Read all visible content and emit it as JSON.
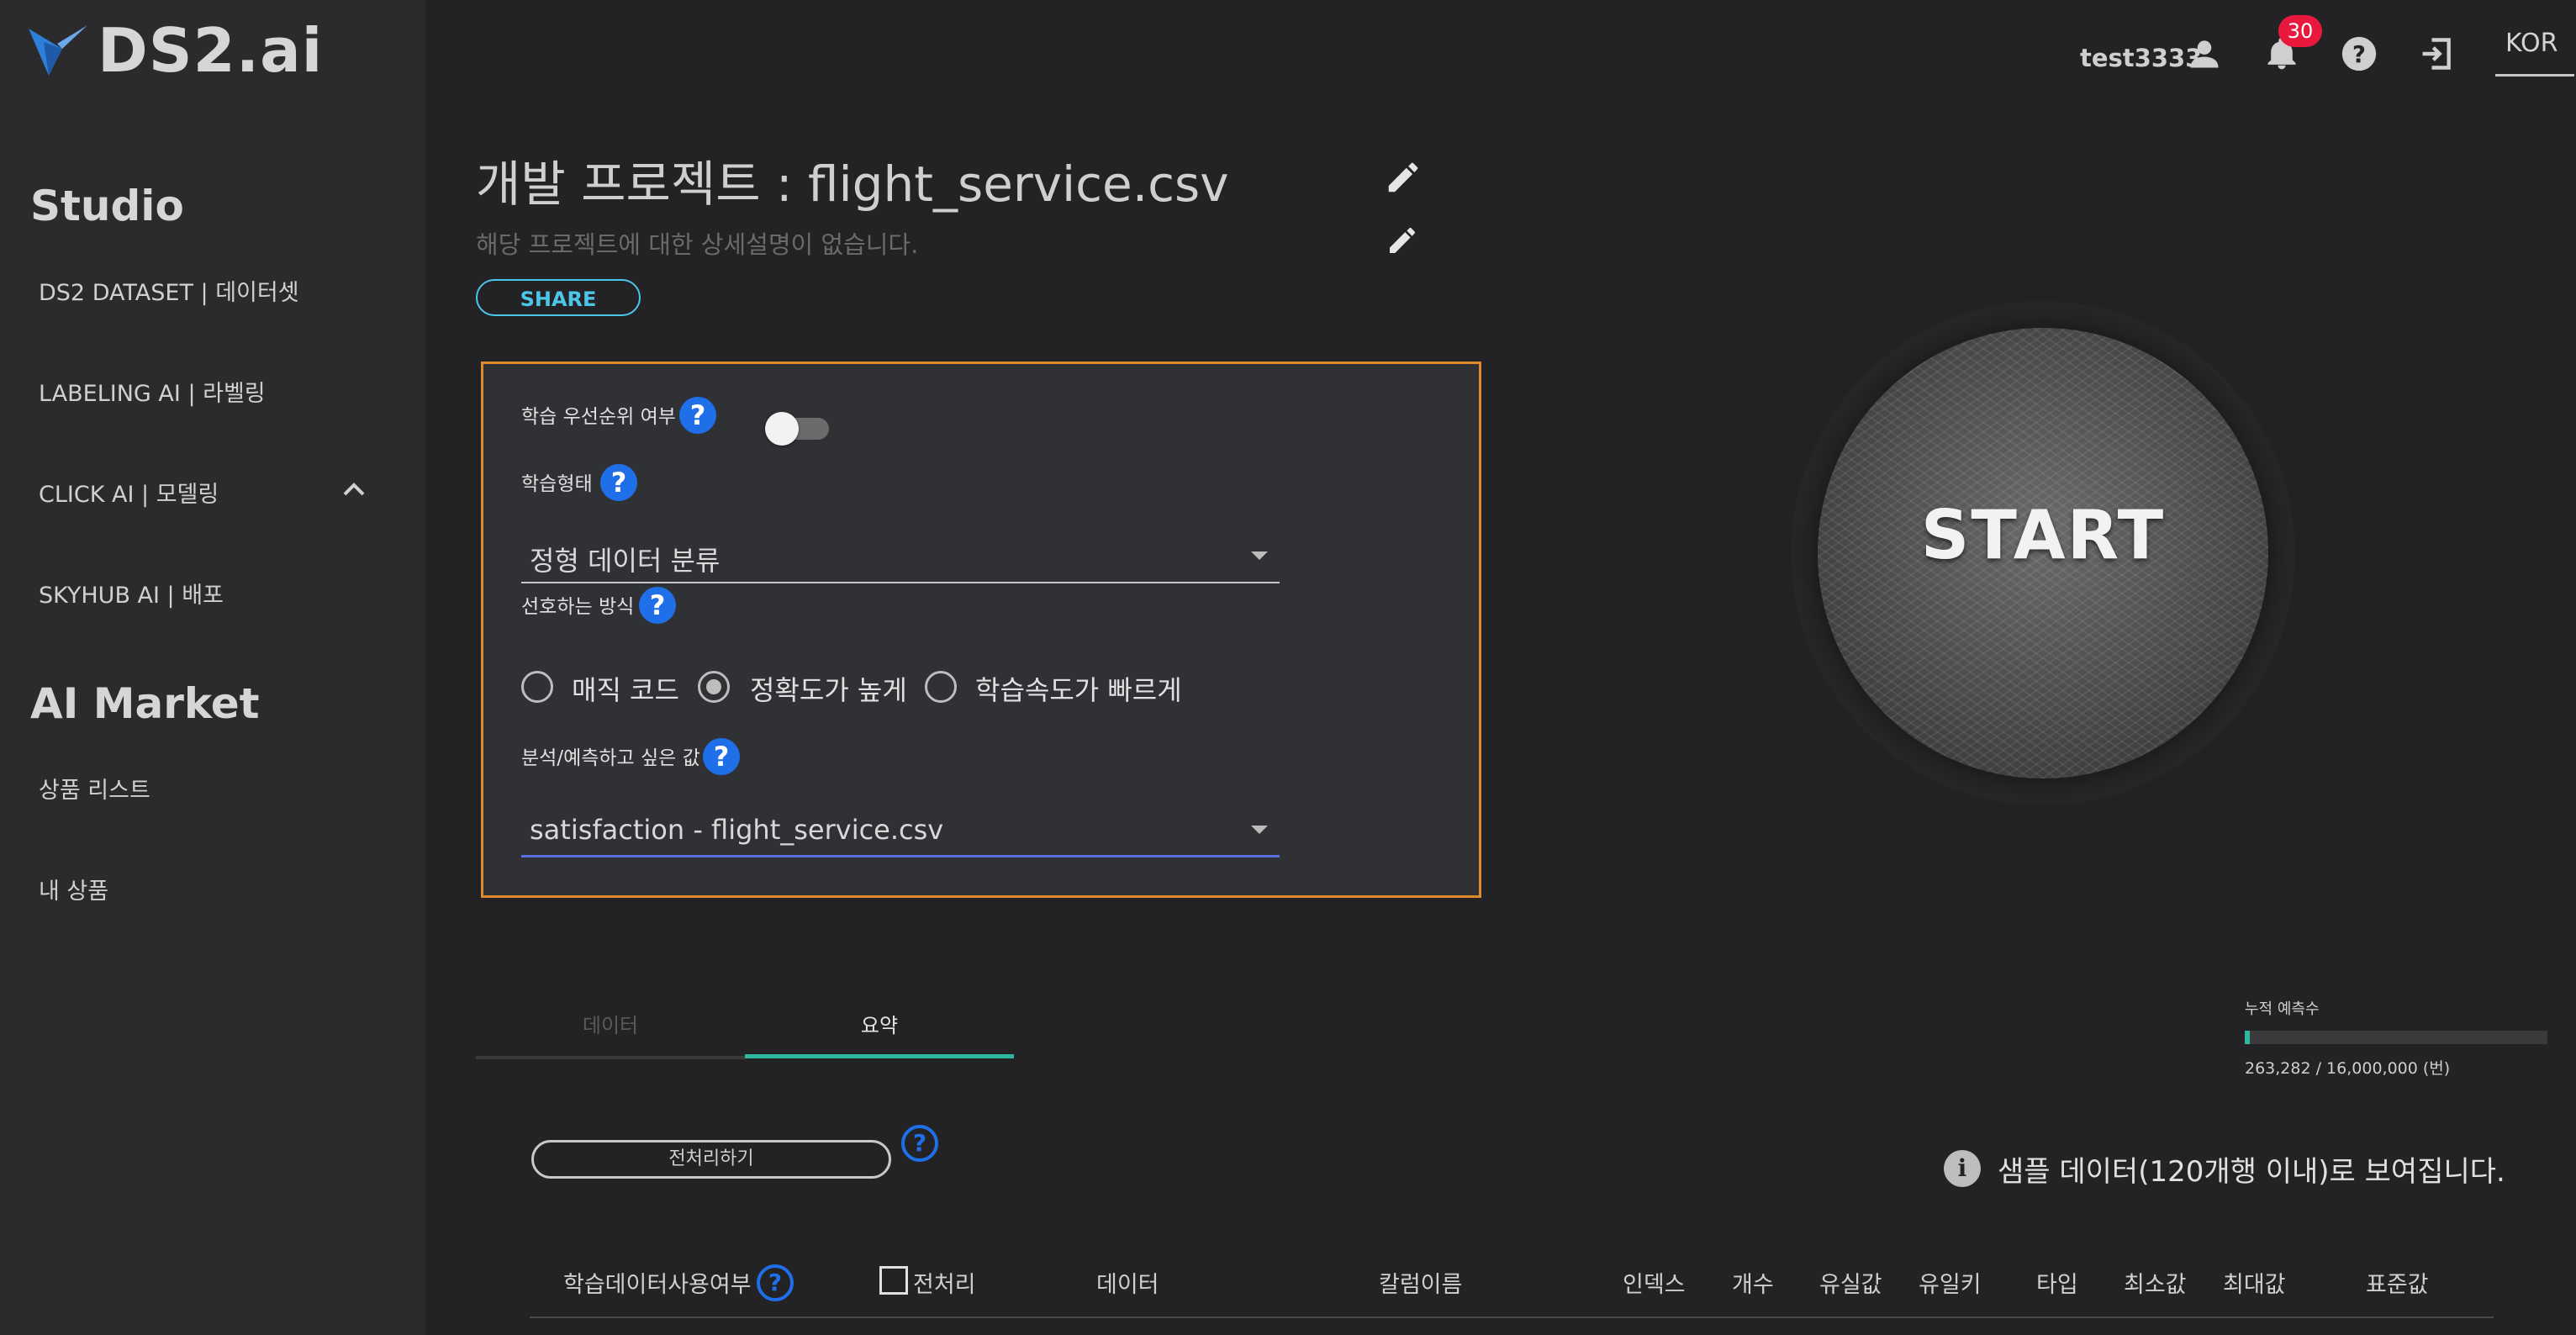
{
  "brand": {
    "logo_text": "DS2.ai"
  },
  "sidebar": {
    "sections": [
      {
        "title": "Studio",
        "items": [
          {
            "label": "DS2 DATASET | 데이터셋"
          },
          {
            "label": "LABELING AI | 라벨링"
          },
          {
            "label": "CLICK AI | 모델링"
          },
          {
            "label": "SKYHUB AI | 배포"
          }
        ]
      },
      {
        "title": "AI Market",
        "items": [
          {
            "label": "상품 리스트"
          },
          {
            "label": "내 상품"
          }
        ]
      }
    ]
  },
  "header": {
    "username": "test3333",
    "notification_count": "30",
    "language": "KOR",
    "icons": [
      "user-icon",
      "bell-icon",
      "help-icon",
      "logout-icon"
    ]
  },
  "project": {
    "title": "개발 프로젝트 : flight_service.csv",
    "description": "해당 프로젝트에 대한 상세설명이 없습니다.",
    "share_label": "SHARE"
  },
  "settings": {
    "priority_label": "학습 우선순위 여부",
    "priority_enabled": false,
    "train_type_label": "학습형태",
    "train_type_value": "정형 데이터 분류",
    "method_label": "선호하는 방식",
    "method_options": [
      "매직 코드",
      "정확도가 높게",
      "학습속도가 빠르게"
    ],
    "method_selected": "정확도가 높게",
    "target_label": "분석/예측하고 싶은 값",
    "target_value": "satisfaction - flight_service.csv",
    "help_glyph": "?"
  },
  "start": {
    "label": "START"
  },
  "tabs": [
    {
      "label": "데이터",
      "active": false
    },
    {
      "label": "요약",
      "active": true
    }
  ],
  "accumulated": {
    "title": "누적 예측수",
    "value_text": "263,282 / 16,000,000 (번)",
    "fraction": 0.0165
  },
  "preprocess": {
    "button_label": "전처리하기",
    "info_text": "샘플 데이터(120개행 이내)로 보여집니다.",
    "info_glyph": "i"
  },
  "table": {
    "headers": [
      "학습데이터사용여부",
      "전처리",
      "데이터",
      "칼럼이름",
      "인덱스",
      "개수",
      "유실값",
      "유일키",
      "타입",
      "최소값",
      "최대값",
      "표준값"
    ]
  },
  "colors": {
    "accent": "#2fb8a0",
    "help": "#1f6fe8",
    "highlight_border": "#e08a2e",
    "badge": "#e8193c",
    "share": "#4cc6e8"
  }
}
